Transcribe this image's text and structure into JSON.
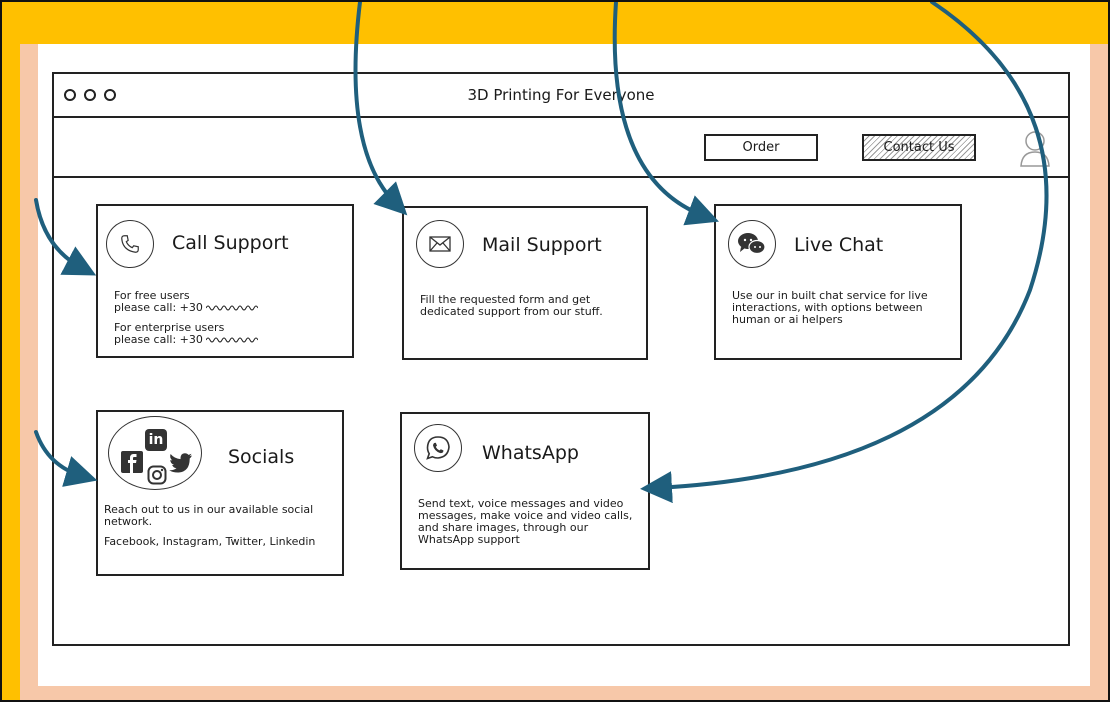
{
  "window": {
    "title": "3D Printing For Everyone"
  },
  "nav": {
    "order_label": "Order",
    "contact_label": "Contact Us"
  },
  "cards": {
    "call": {
      "title": "Call Support",
      "free_line1": "For free users",
      "free_line2": "please call: +30",
      "enterprise_line1": "For enterprise users",
      "enterprise_line2": "please call: +30"
    },
    "mail": {
      "title": "Mail Support",
      "text": "Fill the requested form and get dedicated support from our stuff."
    },
    "chat": {
      "title": "Live Chat",
      "text": "Use our in built chat service for live interactions, with options between human or ai helpers"
    },
    "socials": {
      "title": "Socials",
      "text1": "Reach out to us in our available social network.",
      "text2": "Facebook, Instagram, Twitter, Linkedin",
      "icon_label": "in"
    },
    "whatsapp": {
      "title": "WhatsApp",
      "text": "Send text, voice messages and video messages, make voice and video calls, and share images, through our WhatsApp support"
    }
  },
  "colors": {
    "header_bar": "#ffc000",
    "background": "#f7c8a9",
    "arrow": "#1f5f7d"
  }
}
